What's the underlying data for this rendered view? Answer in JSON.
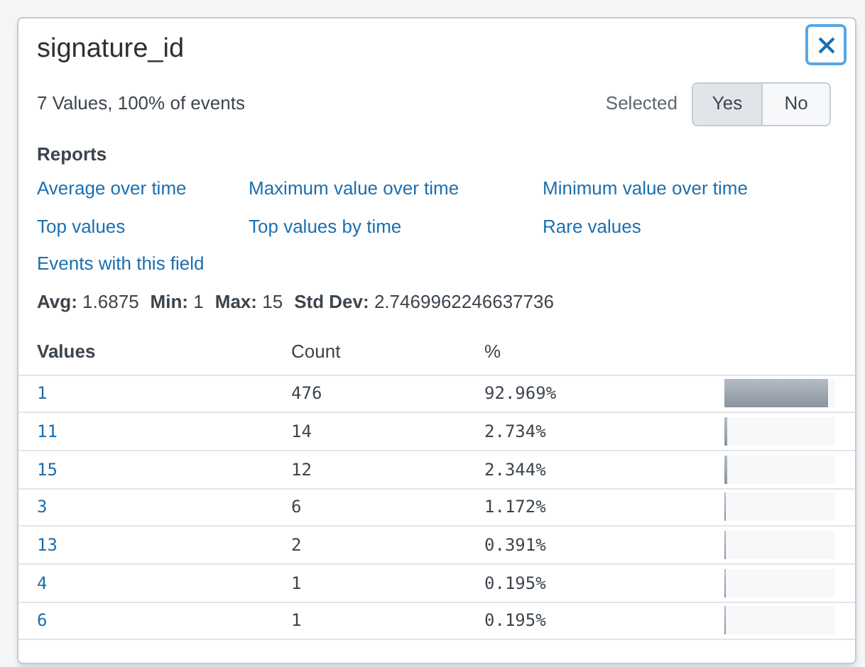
{
  "popup": {
    "title": "signature_id",
    "summary": "7 Values, 100% of events",
    "selected_label": "Selected",
    "selected_options": [
      {
        "label": "Yes",
        "selected": true
      },
      {
        "label": "No",
        "selected": false
      }
    ],
    "reports_heading": "Reports",
    "reports": [
      "Average over time",
      "Maximum value over time",
      "Minimum value over time",
      "Top values",
      "Top values by time",
      "Rare values",
      "Events with this field"
    ],
    "stats": [
      {
        "label": "Avg:",
        "value": "1.6875"
      },
      {
        "label": "Min:",
        "value": "1"
      },
      {
        "label": "Max:",
        "value": "15"
      },
      {
        "label": "Std Dev:",
        "value": "2.7469962246637736"
      }
    ],
    "table": {
      "columns": [
        "Values",
        "Count",
        "%"
      ],
      "rows": [
        {
          "value": "1",
          "count": "476",
          "percent": "92.969%",
          "level": 0.93
        },
        {
          "value": "11",
          "count": "14",
          "percent": "2.734%",
          "level": 0.027
        },
        {
          "value": "15",
          "count": "12",
          "percent": "2.344%",
          "level": 0.023
        },
        {
          "value": "3",
          "count": "6",
          "percent": "1.172%",
          "level": 0.012
        },
        {
          "value": "13",
          "count": "2",
          "percent": "0.391%",
          "level": 0.004
        },
        {
          "value": "4",
          "count": "1",
          "percent": "0.195%",
          "level": 0.002
        },
        {
          "value": "6",
          "count": "1",
          "percent": "0.195%",
          "level": 0.002
        }
      ]
    }
  }
}
